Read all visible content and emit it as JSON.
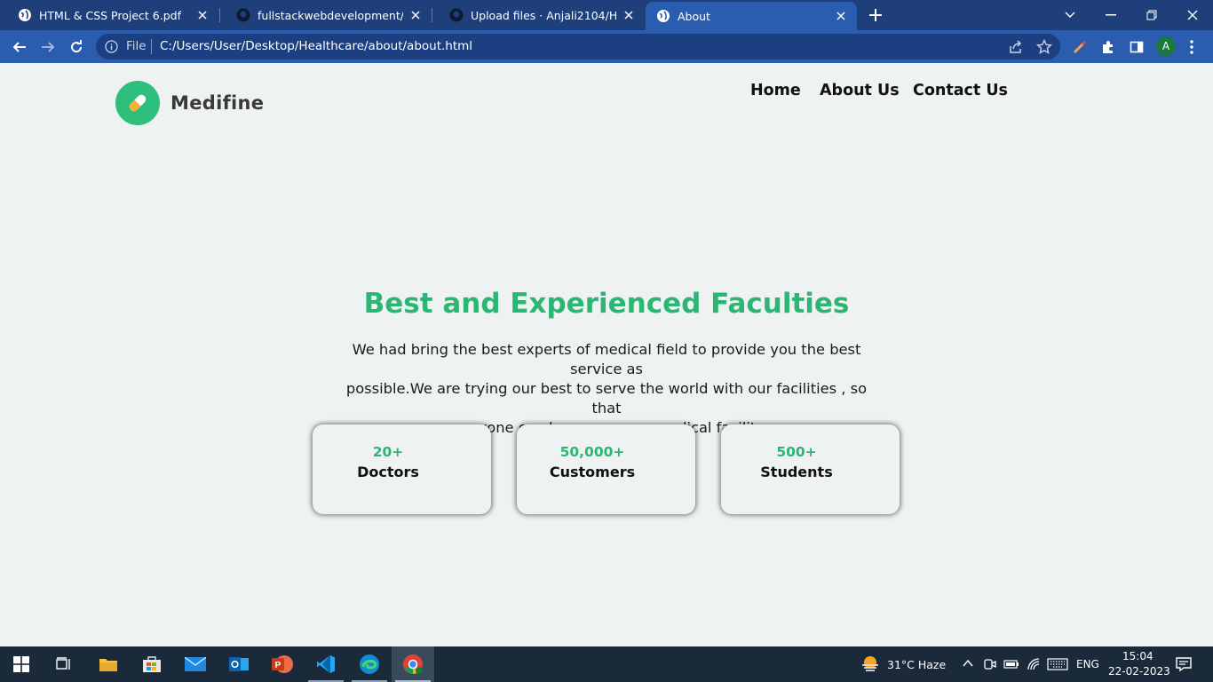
{
  "browser": {
    "tabs": [
      {
        "title": "HTML & CSS Project 6.pdf",
        "icon": "globe-icon"
      },
      {
        "title": "fullstackwebdevelopment/about.html",
        "icon": "github-icon"
      },
      {
        "title": "Upload files · Anjali2104/Healthcare",
        "icon": "github-icon"
      },
      {
        "title": "About",
        "icon": "globe-icon",
        "active": true
      }
    ],
    "address": {
      "scheme_label": "File",
      "url": "C:/Users/User/Desktop/Healthcare/about/about.html"
    },
    "profile_initial": "A"
  },
  "page": {
    "brand": "Medifine",
    "nav": [
      "Home",
      "About Us",
      "Contact Us"
    ],
    "hero": {
      "title": "Best and Experienced Faculties",
      "lines": [
        "We had bring the best experts of medical field to provide you the best service as",
        "possible.We are trying our best to serve the world with our facilities , so that",
        "everyone can have a proper medical facility."
      ]
    },
    "stats": [
      {
        "value": "20+",
        "label": "Doctors"
      },
      {
        "value": "50,000+",
        "label": "Customers"
      },
      {
        "value": "500+",
        "label": "Students"
      }
    ]
  },
  "taskbar": {
    "weather": "31°C  Haze",
    "language": "ENG",
    "time": "15:04",
    "date": "22-02-2023"
  },
  "colors": {
    "accent_green": "#2bb673",
    "browser_tab_bar": "#1f3f7a",
    "browser_toolbar": "#2a5cb0",
    "page_background": "#eff2f3",
    "taskbar": "#1a2a3a"
  }
}
